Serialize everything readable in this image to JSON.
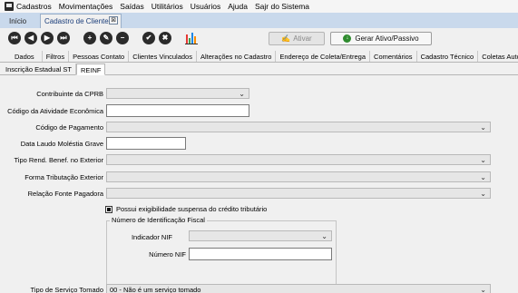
{
  "menu": [
    "Cadastros",
    "Movimentações",
    "Saídas",
    "Utilitários",
    "Usuários",
    "Ajuda",
    "Sajr do Sistema"
  ],
  "tabs": {
    "home": "Início",
    "active": "Cadastro de Clientes",
    "close_glyph": "⊠"
  },
  "toolbar": {
    "nav": [
      "⏮",
      "◀",
      "▶",
      "⏭"
    ],
    "edit": [
      "+",
      "✎",
      "−"
    ],
    "confirm": [
      "✔",
      "✖"
    ],
    "activate_label": "Ativar",
    "generate_label": "Gerar Ativo/Passivo",
    "generate_glyph": "↓",
    "chart_colors": [
      "#e53935",
      "#43a047",
      "#1e88e5",
      "#fb8c00"
    ]
  },
  "main_tabs": [
    "Dados",
    "Filtros",
    "Pessoas Contato",
    "Clientes Vinculados",
    "Alterações no Cadastro",
    "Endereço de Coleta/Entrega",
    "Comentários",
    "Cadastro Técnico",
    "Coletas Automáticas"
  ],
  "sub_tabs": [
    "Inscrição Estadual ST",
    "REINF"
  ],
  "form": {
    "contribuinte_cprb": {
      "label": "Contribuinte da CPRB",
      "value": ""
    },
    "codigo_atividade": {
      "label": "Código da Atividade Econômica",
      "value": ""
    },
    "codigo_pagamento": {
      "label": "Código de Pagamento",
      "value": ""
    },
    "data_laudo": {
      "label": "Data Laudo Moléstia Grave",
      "value": ""
    },
    "tipo_rend": {
      "label": "Tipo Rend. Benef. no Exterior",
      "value": ""
    },
    "forma_tributacao": {
      "label": "Forma Tributação Exterior",
      "value": ""
    },
    "relacao_fonte": {
      "label": "Relação Fonte Pagadora",
      "value": ""
    },
    "exigibilidade": {
      "label": "Possui exigibilidade suspensa do crédito tributário",
      "checked": true
    },
    "nif_group": "Número de Identificação Fiscal",
    "indicador_nif": {
      "label": "Indicador NIF",
      "value": ""
    },
    "numero_nif": {
      "label": "Número NIF",
      "value": ""
    },
    "tipo_servico": {
      "label": "Tipo de Serviço Tomado",
      "value": "00 - Não é um serviço tomado"
    },
    "chevron": "⌄"
  }
}
